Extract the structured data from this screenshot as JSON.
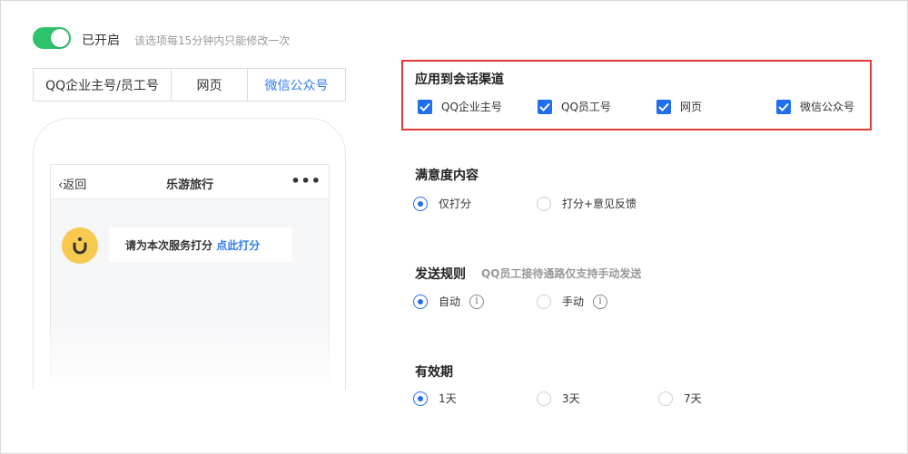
{
  "toggle": {
    "label": "已开启",
    "hint": "该选项每15分钟内只能修改一次",
    "on": true
  },
  "tabs": [
    "QQ企业主号/员工号",
    "网页",
    "微信公众号"
  ],
  "preview": {
    "back": "返回",
    "title": "乐游旅行",
    "more": "•••",
    "message": "请为本次服务打分",
    "action": "点此打分"
  },
  "channels": {
    "title": "应用到会话渠道",
    "options": [
      "QQ企业主号",
      "QQ员工号",
      "网页",
      "微信公众号"
    ]
  },
  "satisfaction": {
    "title": "满意度内容",
    "options": [
      "仅打分",
      "打分+意见反馈"
    ],
    "selected": "仅打分"
  },
  "send_rule": {
    "title": "发送规则",
    "hint": "QQ员工接待通路仅支持手动发送",
    "options": [
      "自动",
      "手动"
    ],
    "selected": "自动"
  },
  "validity": {
    "title": "有效期",
    "options": [
      "1天",
      "3天",
      "7天"
    ],
    "selected": "1天"
  },
  "colors": {
    "accent": "#1f6fef",
    "toggle": "#2dc26b",
    "highlight_border": "#e53935",
    "avatar": "#f7c94f"
  }
}
